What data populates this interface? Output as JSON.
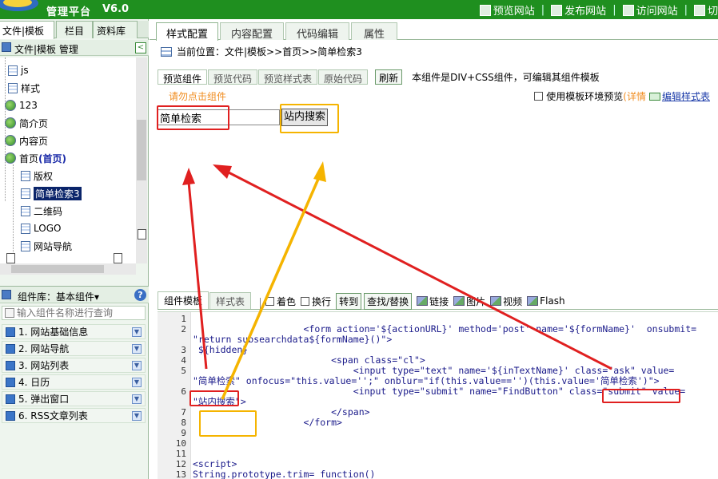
{
  "header": {
    "title": "管理平台",
    "version": "V6.0",
    "links": [
      {
        "label": "预览网站",
        "icon": "preview-icon"
      },
      {
        "label": "发布网站",
        "icon": "publish-icon"
      },
      {
        "label": "访问网站",
        "icon": "visit-icon"
      },
      {
        "label": "切",
        "icon": "switch-icon"
      }
    ],
    "accent": "#1f8f1f"
  },
  "sidebar": {
    "tabs": [
      "文件|模板",
      "栏目",
      "资料库"
    ],
    "panel_title": "文件|模板 管理",
    "tree": [
      {
        "label": "js",
        "type": "page"
      },
      {
        "label": "样式",
        "type": "page"
      },
      {
        "label": "123",
        "type": "folder"
      },
      {
        "label": "简介页",
        "type": "folder"
      },
      {
        "label": "内容页",
        "type": "folder"
      },
      {
        "label": "首页",
        "suffix": "(首页)",
        "type": "folder"
      },
      {
        "label": "版权",
        "type": "page"
      },
      {
        "label": "简单检索3",
        "type": "page",
        "selected": true
      },
      {
        "label": "二维码",
        "type": "page"
      },
      {
        "label": "LOGO",
        "type": "page"
      },
      {
        "label": "网站导航",
        "type": "page"
      }
    ],
    "component_library": "组件库：基本组件▾",
    "search_placeholder": "输入组件名称进行查询",
    "categories": [
      "1. 网站基础信息",
      "2. 网站导航",
      "3. 网站列表",
      "4. 日历",
      "5. 弹出窗口",
      "6. RSS文章列表"
    ]
  },
  "main": {
    "tabs": [
      "样式配置",
      "内容配置",
      "代码编辑",
      "属性"
    ],
    "breadcrumb": "当前位置：文件|模板>>首页>>简单检索3",
    "subtabs": [
      "预览组件",
      "预览代码",
      "预览样式表",
      "原始代码"
    ],
    "refresh_label": "刷新",
    "description": "本组件是DIV+CSS组件，可编辑其组件模板",
    "warning": "请勿点击组件",
    "options": {
      "use_env": "使用模板环境预览",
      "detail": "(详情",
      "edit_css": "编辑样式表"
    },
    "preview": {
      "input_value": "简单检索",
      "button_label": "站内搜索"
    },
    "editor_tabs": [
      "组件模板",
      "样式表"
    ],
    "tools": [
      "着色",
      "换行",
      "转到",
      "查找/替换",
      "链接",
      "图片",
      "视频",
      "Flash"
    ],
    "code_lines": [
      {
        "n": "1",
        "text": ""
      },
      {
        "n": "2",
        "text": "                    <form action='${actionURL}' method='post' name='${formName}'  onsubmit="
      },
      {
        "n": "",
        "text": "\"return subsearchdata${formName}()\">"
      },
      {
        "n": "3",
        "text": " ${hidden}"
      },
      {
        "n": "4",
        "text": "                         <span class=\"cl\">"
      },
      {
        "n": "5",
        "text": "                             <input type=\"text\" name='${inTextName}' class=\"ask\" value="
      },
      {
        "n": "",
        "text": "\"简单检索\" onfocus=\"this.value='';\" onblur=\"if(this.value=='')(this.value='简单检索')\">"
      },
      {
        "n": "6",
        "text": "                             <input type=\"submit\" name=\"FindButton\" class=\"submit\" value="
      },
      {
        "n": "",
        "text": "\"站内搜索\">"
      },
      {
        "n": "7",
        "text": "                         </span>"
      },
      {
        "n": "8",
        "text": "                    </form>"
      },
      {
        "n": "9",
        "text": ""
      },
      {
        "n": "10",
        "text": ""
      },
      {
        "n": "11",
        "text": ""
      },
      {
        "n": "12",
        "text": "<script>"
      },
      {
        "n": "13",
        "text": "String.prototype.trim= function()"
      }
    ]
  },
  "annotation_colors": {
    "red": "#e02020",
    "orange": "#f5b400"
  }
}
